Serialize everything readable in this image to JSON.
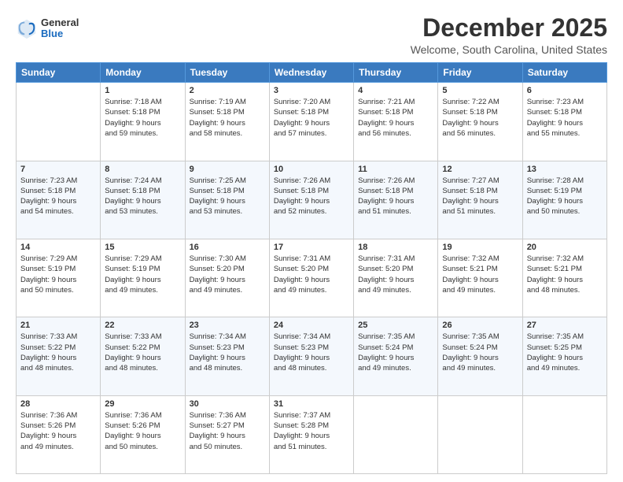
{
  "header": {
    "logo_general": "General",
    "logo_blue": "Blue",
    "month": "December 2025",
    "location": "Welcome, South Carolina, United States"
  },
  "days_of_week": [
    "Sunday",
    "Monday",
    "Tuesday",
    "Wednesday",
    "Thursday",
    "Friday",
    "Saturday"
  ],
  "weeks": [
    [
      {
        "day": "",
        "info": ""
      },
      {
        "day": "1",
        "info": "Sunrise: 7:18 AM\nSunset: 5:18 PM\nDaylight: 9 hours\nand 59 minutes."
      },
      {
        "day": "2",
        "info": "Sunrise: 7:19 AM\nSunset: 5:18 PM\nDaylight: 9 hours\nand 58 minutes."
      },
      {
        "day": "3",
        "info": "Sunrise: 7:20 AM\nSunset: 5:18 PM\nDaylight: 9 hours\nand 57 minutes."
      },
      {
        "day": "4",
        "info": "Sunrise: 7:21 AM\nSunset: 5:18 PM\nDaylight: 9 hours\nand 56 minutes."
      },
      {
        "day": "5",
        "info": "Sunrise: 7:22 AM\nSunset: 5:18 PM\nDaylight: 9 hours\nand 56 minutes."
      },
      {
        "day": "6",
        "info": "Sunrise: 7:23 AM\nSunset: 5:18 PM\nDaylight: 9 hours\nand 55 minutes."
      }
    ],
    [
      {
        "day": "7",
        "info": "Sunrise: 7:23 AM\nSunset: 5:18 PM\nDaylight: 9 hours\nand 54 minutes."
      },
      {
        "day": "8",
        "info": "Sunrise: 7:24 AM\nSunset: 5:18 PM\nDaylight: 9 hours\nand 53 minutes."
      },
      {
        "day": "9",
        "info": "Sunrise: 7:25 AM\nSunset: 5:18 PM\nDaylight: 9 hours\nand 53 minutes."
      },
      {
        "day": "10",
        "info": "Sunrise: 7:26 AM\nSunset: 5:18 PM\nDaylight: 9 hours\nand 52 minutes."
      },
      {
        "day": "11",
        "info": "Sunrise: 7:26 AM\nSunset: 5:18 PM\nDaylight: 9 hours\nand 51 minutes."
      },
      {
        "day": "12",
        "info": "Sunrise: 7:27 AM\nSunset: 5:18 PM\nDaylight: 9 hours\nand 51 minutes."
      },
      {
        "day": "13",
        "info": "Sunrise: 7:28 AM\nSunset: 5:19 PM\nDaylight: 9 hours\nand 50 minutes."
      }
    ],
    [
      {
        "day": "14",
        "info": "Sunrise: 7:29 AM\nSunset: 5:19 PM\nDaylight: 9 hours\nand 50 minutes."
      },
      {
        "day": "15",
        "info": "Sunrise: 7:29 AM\nSunset: 5:19 PM\nDaylight: 9 hours\nand 49 minutes."
      },
      {
        "day": "16",
        "info": "Sunrise: 7:30 AM\nSunset: 5:20 PM\nDaylight: 9 hours\nand 49 minutes."
      },
      {
        "day": "17",
        "info": "Sunrise: 7:31 AM\nSunset: 5:20 PM\nDaylight: 9 hours\nand 49 minutes."
      },
      {
        "day": "18",
        "info": "Sunrise: 7:31 AM\nSunset: 5:20 PM\nDaylight: 9 hours\nand 49 minutes."
      },
      {
        "day": "19",
        "info": "Sunrise: 7:32 AM\nSunset: 5:21 PM\nDaylight: 9 hours\nand 49 minutes."
      },
      {
        "day": "20",
        "info": "Sunrise: 7:32 AM\nSunset: 5:21 PM\nDaylight: 9 hours\nand 48 minutes."
      }
    ],
    [
      {
        "day": "21",
        "info": "Sunrise: 7:33 AM\nSunset: 5:22 PM\nDaylight: 9 hours\nand 48 minutes."
      },
      {
        "day": "22",
        "info": "Sunrise: 7:33 AM\nSunset: 5:22 PM\nDaylight: 9 hours\nand 48 minutes."
      },
      {
        "day": "23",
        "info": "Sunrise: 7:34 AM\nSunset: 5:23 PM\nDaylight: 9 hours\nand 48 minutes."
      },
      {
        "day": "24",
        "info": "Sunrise: 7:34 AM\nSunset: 5:23 PM\nDaylight: 9 hours\nand 48 minutes."
      },
      {
        "day": "25",
        "info": "Sunrise: 7:35 AM\nSunset: 5:24 PM\nDaylight: 9 hours\nand 49 minutes."
      },
      {
        "day": "26",
        "info": "Sunrise: 7:35 AM\nSunset: 5:24 PM\nDaylight: 9 hours\nand 49 minutes."
      },
      {
        "day": "27",
        "info": "Sunrise: 7:35 AM\nSunset: 5:25 PM\nDaylight: 9 hours\nand 49 minutes."
      }
    ],
    [
      {
        "day": "28",
        "info": "Sunrise: 7:36 AM\nSunset: 5:26 PM\nDaylight: 9 hours\nand 49 minutes."
      },
      {
        "day": "29",
        "info": "Sunrise: 7:36 AM\nSunset: 5:26 PM\nDaylight: 9 hours\nand 50 minutes."
      },
      {
        "day": "30",
        "info": "Sunrise: 7:36 AM\nSunset: 5:27 PM\nDaylight: 9 hours\nand 50 minutes."
      },
      {
        "day": "31",
        "info": "Sunrise: 7:37 AM\nSunset: 5:28 PM\nDaylight: 9 hours\nand 51 minutes."
      },
      {
        "day": "",
        "info": ""
      },
      {
        "day": "",
        "info": ""
      },
      {
        "day": "",
        "info": ""
      }
    ]
  ]
}
